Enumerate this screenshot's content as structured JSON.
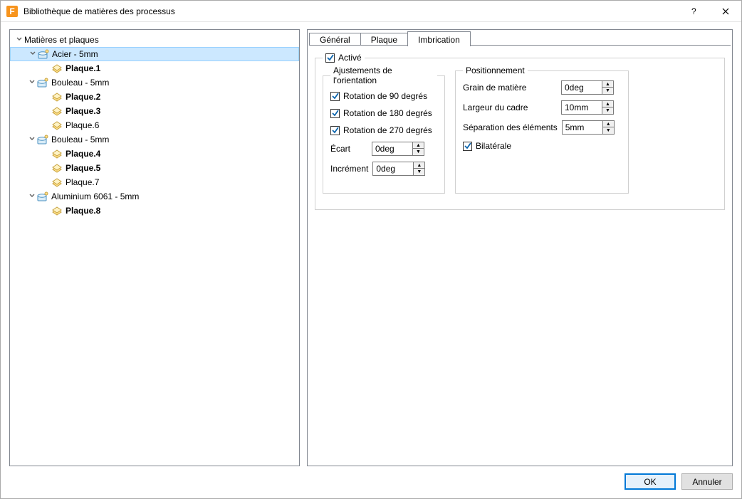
{
  "window": {
    "title": "Bibliothèque de matières des processus",
    "app_icon_letter": "F"
  },
  "tree": {
    "root_label": "Matières et plaques",
    "materials": [
      {
        "label": "Acier - 5mm",
        "selected": true,
        "plates": [
          {
            "label": "Plaque.1",
            "bold": true
          }
        ]
      },
      {
        "label": "Bouleau - 5mm",
        "selected": false,
        "plates": [
          {
            "label": "Plaque.2",
            "bold": true
          },
          {
            "label": "Plaque.3",
            "bold": true
          },
          {
            "label": "Plaque.6",
            "bold": false
          }
        ]
      },
      {
        "label": "Bouleau - 5mm",
        "selected": false,
        "plates": [
          {
            "label": "Plaque.4",
            "bold": true
          },
          {
            "label": "Plaque.5",
            "bold": true
          },
          {
            "label": "Plaque.7",
            "bold": false
          }
        ]
      },
      {
        "label": "Aluminium 6061 - 5mm",
        "selected": false,
        "plates": [
          {
            "label": "Plaque.8",
            "bold": true
          }
        ]
      }
    ]
  },
  "tabs": {
    "general": "Général",
    "plaque": "Plaque",
    "imbrication": "Imbrication",
    "active": "imbrication"
  },
  "nesting": {
    "enabled_label": "Activé",
    "enabled": true,
    "orientation": {
      "legend": "Ajustements de l'orientation",
      "rot90_label": "Rotation de 90 degrés",
      "rot90": true,
      "rot180_label": "Rotation de 180 degrés",
      "rot180": true,
      "rot270_label": "Rotation de 270 degrés",
      "rot270": true,
      "ecart_label": "Écart",
      "ecart_value": "0deg",
      "increment_label": "Incrément",
      "increment_value": "0deg"
    },
    "positioning": {
      "legend": "Positionnement",
      "grain_label": "Grain de matière",
      "grain_value": "0deg",
      "frame_label": "Largeur du cadre",
      "frame_value": "10mm",
      "sep_label": "Séparation des éléments",
      "sep_value": "5mm",
      "bilateral_label": "Bilatérale",
      "bilateral": true
    }
  },
  "buttons": {
    "ok": "OK",
    "cancel": "Annuler"
  }
}
